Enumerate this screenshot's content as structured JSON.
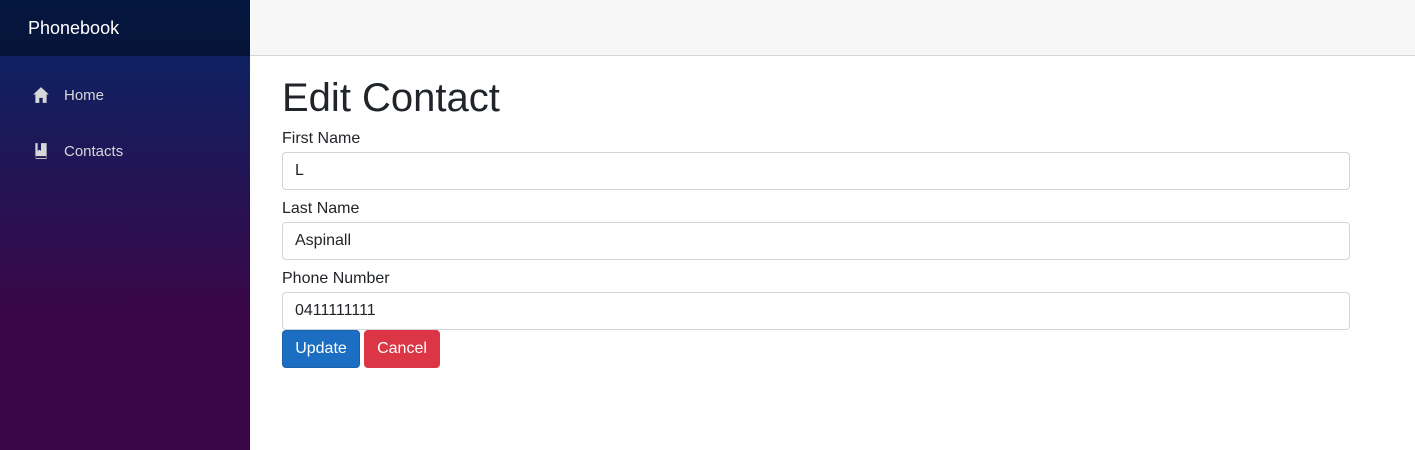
{
  "sidebar": {
    "brand": "Phonebook",
    "items": [
      {
        "label": "Home",
        "icon": "home-icon"
      },
      {
        "label": "Contacts",
        "icon": "book-icon"
      }
    ]
  },
  "page": {
    "title": "Edit Contact"
  },
  "form": {
    "first_name": {
      "label": "First Name",
      "value": "L"
    },
    "last_name": {
      "label": "Last Name",
      "value": "Aspinall"
    },
    "phone": {
      "label": "Phone Number",
      "value": "0411111111"
    }
  },
  "actions": {
    "update_label": "Update",
    "cancel_label": "Cancel"
  },
  "colors": {
    "primary": "#1b6ec2",
    "danger": "#dc3545",
    "sidebar_top": "#052767",
    "sidebar_bottom": "#3a0647"
  }
}
